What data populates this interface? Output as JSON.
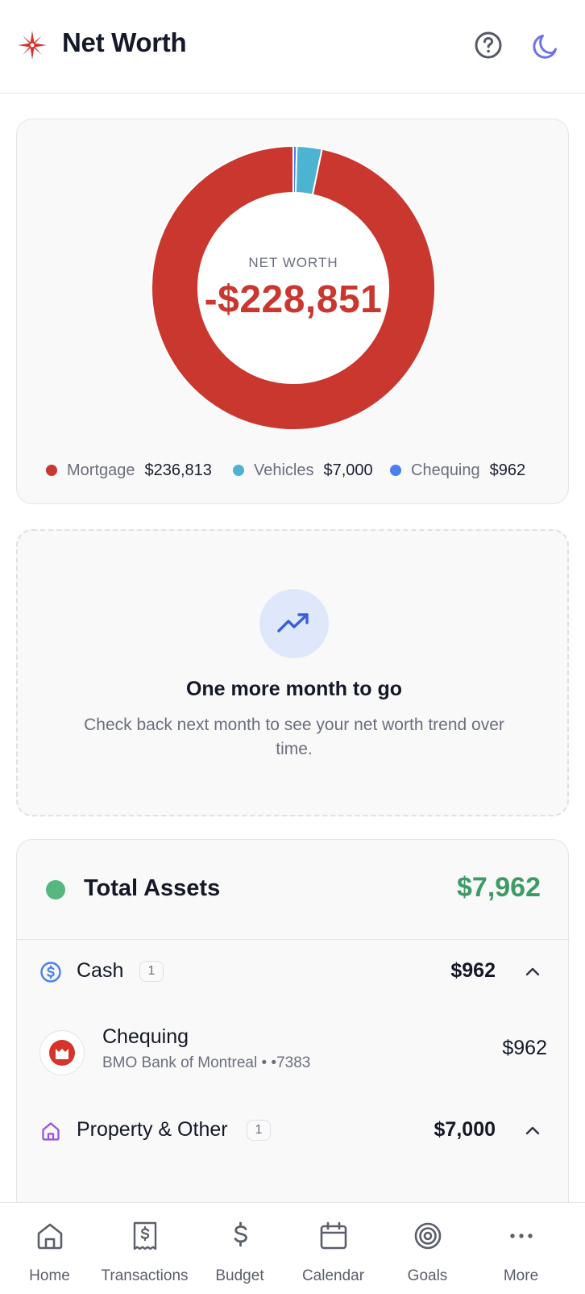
{
  "header": {
    "title": "Net Worth",
    "logo_icon": "compass-star-icon",
    "help_icon": "question-circle-icon",
    "theme_icon": "moon-icon"
  },
  "summary": {
    "label": "NET WORTH",
    "value": "-$228,851"
  },
  "chart_data": {
    "type": "pie",
    "categories": [
      "Mortgage",
      "Vehicles",
      "Chequing"
    ],
    "values": [
      236813,
      7000,
      962
    ],
    "value_labels": [
      "$236,813",
      "$7,000",
      "$962"
    ],
    "colors": [
      "#c9372f",
      "#4db3d3",
      "#4a7ff0"
    ],
    "legend_position": "bottom",
    "center_label": "NET WORTH",
    "center_value": "-$228,851"
  },
  "trend_empty": {
    "icon": "trending-up-icon",
    "title": "One more month to go",
    "text": "Check back next month to see your net worth trend over time."
  },
  "assets": {
    "title": "Total Assets",
    "total": "$7,962",
    "color": "#3f9b66",
    "groups": [
      {
        "label": "Cash",
        "count": "1",
        "amount": "$962",
        "icon": "dollar-circle-icon",
        "accounts": [
          {
            "name": "Chequing",
            "institution": "BMO Bank of Montreal",
            "mask": "• •7383",
            "amount": "$962",
            "logo": "bmo-logo-icon"
          }
        ]
      },
      {
        "label": "Property & Other",
        "count": "1",
        "amount": "$7,000",
        "icon": "house-icon"
      }
    ]
  },
  "tabs": [
    {
      "label": "Home",
      "icon": "home-icon"
    },
    {
      "label": "Transactions",
      "icon": "receipt-icon"
    },
    {
      "label": "Budget",
      "icon": "dollar-icon"
    },
    {
      "label": "Calendar",
      "icon": "calendar-icon"
    },
    {
      "label": "Goals",
      "icon": "target-icon"
    },
    {
      "label": "More",
      "icon": "more-dots-icon"
    }
  ]
}
